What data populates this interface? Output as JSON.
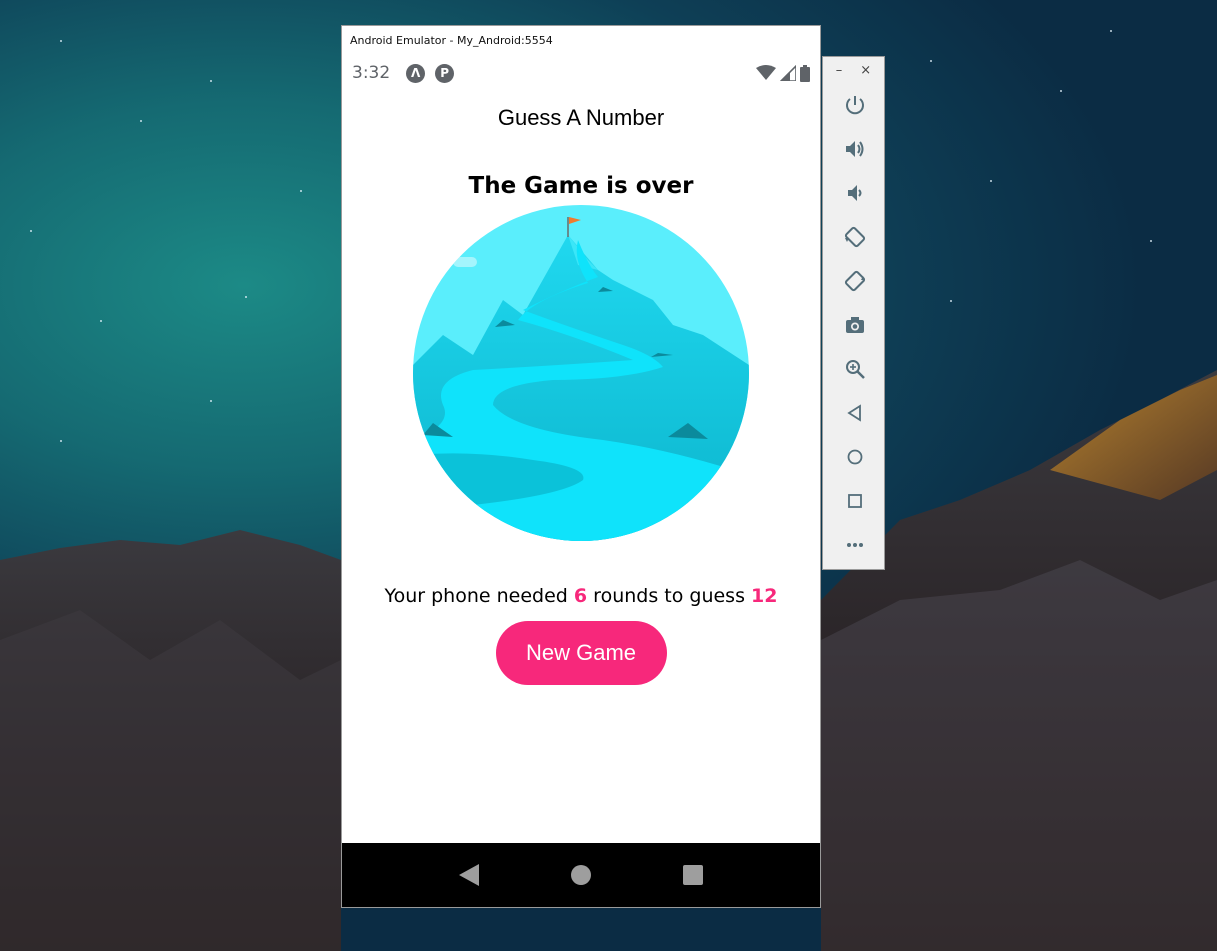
{
  "window": {
    "title": "Android Emulator - My_Android:5554"
  },
  "status_bar": {
    "time": "3:32"
  },
  "app": {
    "header_title": "Guess A Number",
    "screen_title": "The Game is over",
    "result": {
      "prefix": "Your phone needed",
      "rounds": "6",
      "middle": "rounds to guess",
      "number": "12"
    },
    "new_game_label": "New Game"
  },
  "toolbar": {
    "minimize": "–",
    "close": "×",
    "buttons": [
      "power-icon",
      "volume-up-icon",
      "volume-down-icon",
      "rotate-left-icon",
      "rotate-right-icon",
      "camera-icon",
      "zoom-icon",
      "back-icon",
      "home-icon",
      "overview-icon",
      "more-icon"
    ]
  },
  "colors": {
    "accent": "#f7287b",
    "illustration_sky": "#5aeefc",
    "illustration_water": "#0fe3fb"
  }
}
